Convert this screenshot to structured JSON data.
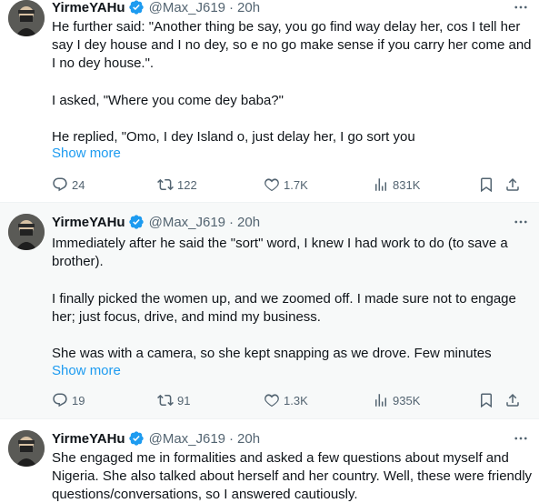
{
  "colors": {
    "link": "#1d9bf0",
    "secondary": "#536471",
    "text": "#0f1419",
    "verified": "#1d9bf0"
  },
  "tweets": [
    {
      "author": {
        "name": "YirmeYAHu",
        "handle": "@Max_J619",
        "time": "20h"
      },
      "paragraphs": [
        "He further said: \"Another thing be say, you go find way delay her, cos I tell her say I dey house and I no dey, so e no go make sense if you carry her come and I no dey house.\".",
        "I asked, \"Where you come dey baba?\"",
        "He replied, \"Omo, I dey Island o, just delay her, I go sort you"
      ],
      "show_more": "Show more",
      "stats": {
        "replies": "24",
        "reposts": "122",
        "likes": "1.7K",
        "views": "831K"
      }
    },
    {
      "author": {
        "name": "YirmeYAHu",
        "handle": "@Max_J619",
        "time": "20h"
      },
      "paragraphs": [
        "Immediately after he said the \"sort\" word, I knew I had work to do (to save a brother).",
        "I finally picked the women up, and we zoomed off. I made sure not to engage her; just focus, drive, and mind my business.",
        "She was with a camera, so she kept snapping as we drove. Few minutes"
      ],
      "show_more": "Show more",
      "stats": {
        "replies": "19",
        "reposts": "91",
        "likes": "1.3K",
        "views": "935K"
      }
    },
    {
      "author": {
        "name": "YirmeYAHu",
        "handle": "@Max_J619",
        "time": "20h"
      },
      "paragraphs": [
        "She engaged me in formalities and asked a few questions about myself and Nigeria. She also talked about herself and her country. Well, these were friendly questions/conversations, so I answered cautiously."
      ]
    }
  ],
  "separator": "·",
  "icons": {
    "verified": "verified-badge-icon",
    "more": "more-horizontal-icon",
    "reply": "reply-icon",
    "repost": "repost-icon",
    "like": "heart-icon",
    "views": "views-bar-chart-icon",
    "bookmark": "bookmark-icon",
    "share": "share-icon"
  }
}
